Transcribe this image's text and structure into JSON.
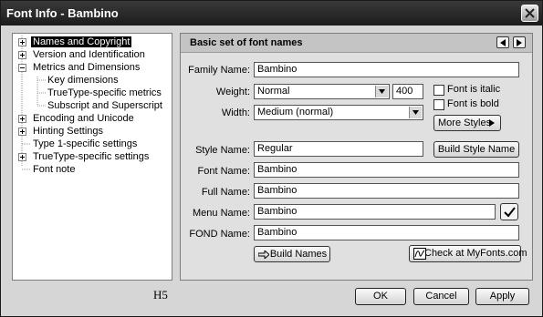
{
  "window": {
    "title": "Font Info - Bambino"
  },
  "tree": {
    "items": [
      {
        "label": "Names and Copyright",
        "expander": "plus"
      },
      {
        "label": "Version and Identification",
        "expander": "plus"
      },
      {
        "label": "Metrics and Dimensions",
        "expander": "minus"
      },
      {
        "label": "Key dimensions",
        "expander": "none"
      },
      {
        "label": "TrueType-specific metrics",
        "expander": "none"
      },
      {
        "label": "Subscript and Superscript",
        "expander": "none"
      },
      {
        "label": "Encoding and Unicode",
        "expander": "plus"
      },
      {
        "label": "Hinting Settings",
        "expander": "plus"
      },
      {
        "label": "Type 1-specific settings",
        "expander": "none"
      },
      {
        "label": "TrueType-specific settings",
        "expander": "plus"
      },
      {
        "label": "Font note",
        "expander": "none"
      }
    ],
    "selected": "Names and Copyright",
    "watermark": "H5"
  },
  "panel": {
    "title": "Basic set of font names",
    "fields": {
      "family_name": {
        "label": "Family Name:",
        "value": "Bambino"
      },
      "weight": {
        "label": "Weight:",
        "value": "Normal",
        "number": "400"
      },
      "width": {
        "label": "Width:",
        "value": "Medium (normal)"
      },
      "style_name": {
        "label": "Style Name:",
        "value": "Regular"
      },
      "font_name": {
        "label": "Font Name:",
        "value": "Bambino"
      },
      "full_name": {
        "label": "Full Name:",
        "value": "Bambino"
      },
      "menu_name": {
        "label": "Menu Name:",
        "value": "Bambino"
      },
      "fond_name": {
        "label": "FOND Name:",
        "value": "Bambino"
      }
    },
    "checkboxes": {
      "italic": "Font is italic",
      "bold": "Font is bold"
    },
    "buttons": {
      "more_styles": "More Styles",
      "build_style_name": "Build Style Name",
      "build_names": "Build Names",
      "check_myfonts": "Check at MyFonts.com"
    }
  },
  "dialog_buttons": {
    "ok": "OK",
    "cancel": "Cancel",
    "apply": "Apply"
  }
}
